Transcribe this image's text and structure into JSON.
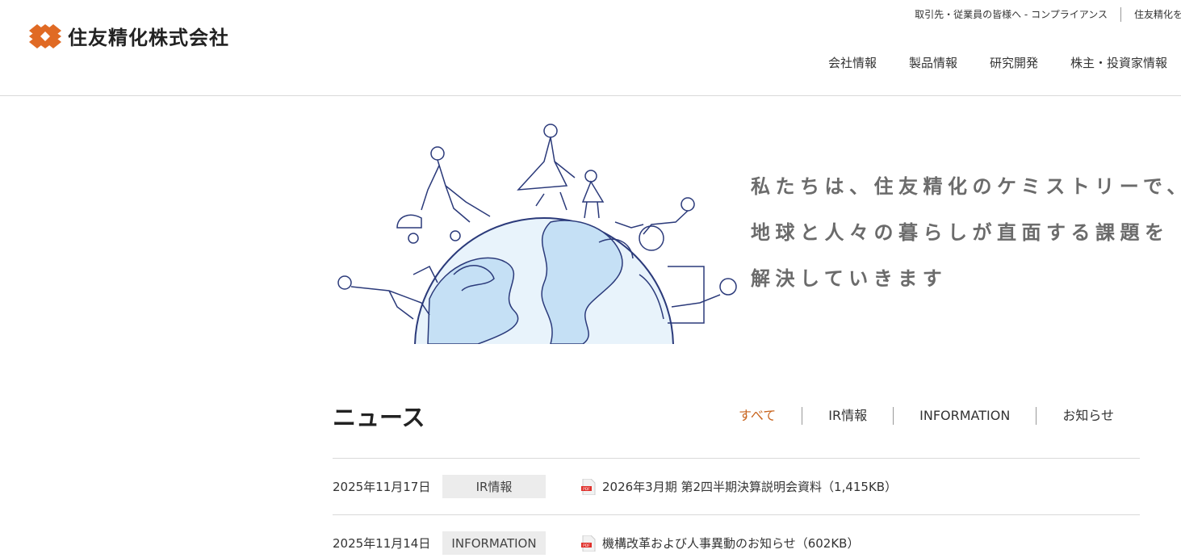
{
  "header": {
    "logo_text": "住友精化株式会社",
    "brand_color": "#e06a24",
    "util_nav": [
      {
        "label": "取引先・従業員の皆様へ - コンプライアンス"
      },
      {
        "label": "住友精化を退"
      }
    ],
    "global_nav": [
      {
        "label": "会社情報"
      },
      {
        "label": "製品情報"
      },
      {
        "label": "研究開発"
      },
      {
        "label": "株主・投資家情報"
      }
    ]
  },
  "hero": {
    "lines": [
      "私たちは、住友精化のケミストリーで、",
      "地球と人々の暮らしが直面する課題を",
      "解決していきます"
    ]
  },
  "news": {
    "title": "ニュース",
    "tabs": [
      {
        "label": "すべて",
        "active": true
      },
      {
        "label": "IR情報",
        "active": false
      },
      {
        "label": "INFORMATION",
        "active": false
      },
      {
        "label": "お知らせ",
        "active": false
      }
    ],
    "accent_color": "#c8641e",
    "items": [
      {
        "date": "2025年11月17日",
        "category": "IR情報",
        "title": "2026年3月期 第2四半期決算説明会資料（1,415KB）",
        "icon": "pdf-icon"
      },
      {
        "date": "2025年11月14日",
        "category": "INFORMATION",
        "title": "機構改革および人事異動のお知らせ（602KB）",
        "icon": "pdf-icon"
      }
    ]
  }
}
